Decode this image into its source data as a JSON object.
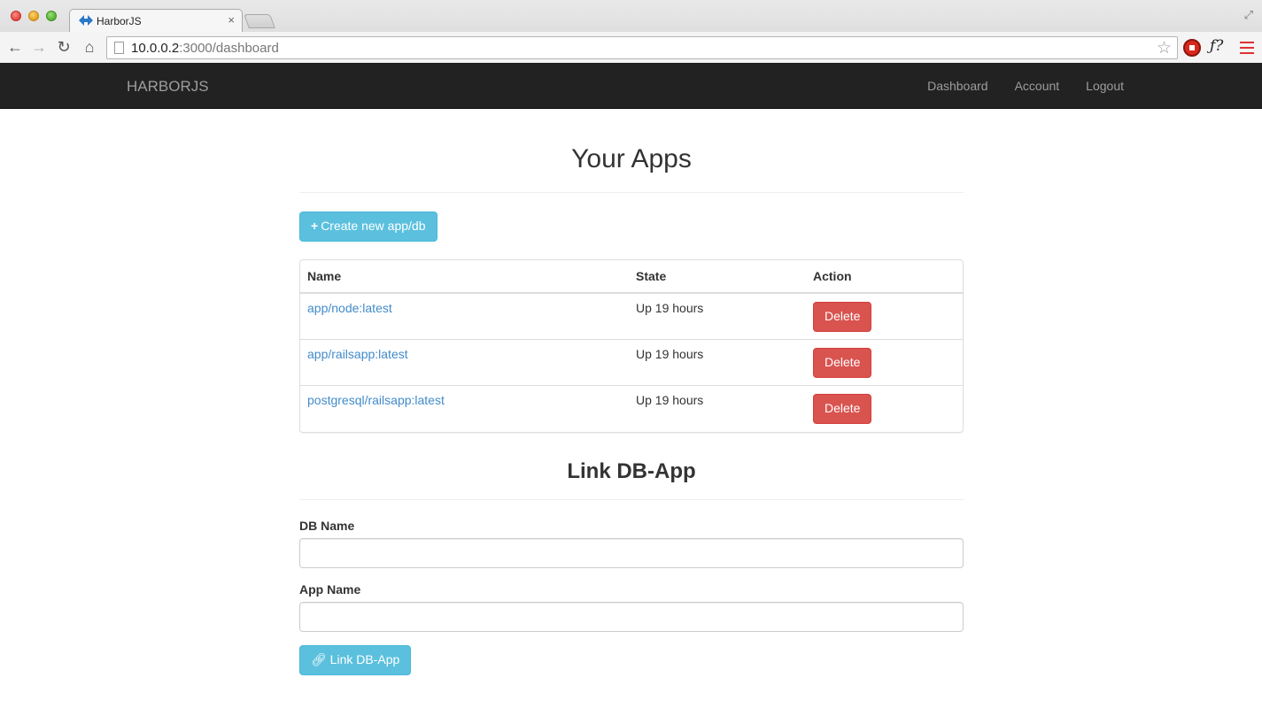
{
  "browser": {
    "tab_title": "HarborJS",
    "tab_close": "×",
    "url_host": "10.0.0.2",
    "url_rest": ":3000/dashboard"
  },
  "navbar": {
    "brand": "HARBORJS",
    "links": [
      "Dashboard",
      "Account",
      "Logout"
    ]
  },
  "apps": {
    "title": "Your Apps",
    "create_button": "Create new app/db",
    "columns": [
      "Name",
      "State",
      "Action"
    ],
    "rows": [
      {
        "name": "app/node:latest",
        "state": "Up 19 hours",
        "action": "Delete"
      },
      {
        "name": "app/railsapp:latest",
        "state": "Up 19 hours",
        "action": "Delete"
      },
      {
        "name": "postgresql/railsapp:latest",
        "state": "Up 19 hours",
        "action": "Delete"
      }
    ]
  },
  "link_form": {
    "title": "Link DB-App",
    "db_label": "DB Name",
    "db_value": "",
    "app_label": "App Name",
    "app_value": "",
    "submit": "Link DB-App"
  },
  "colors": {
    "navbar": "#222222",
    "info": "#5bc0de",
    "danger": "#d9534f",
    "link": "#428bca"
  }
}
